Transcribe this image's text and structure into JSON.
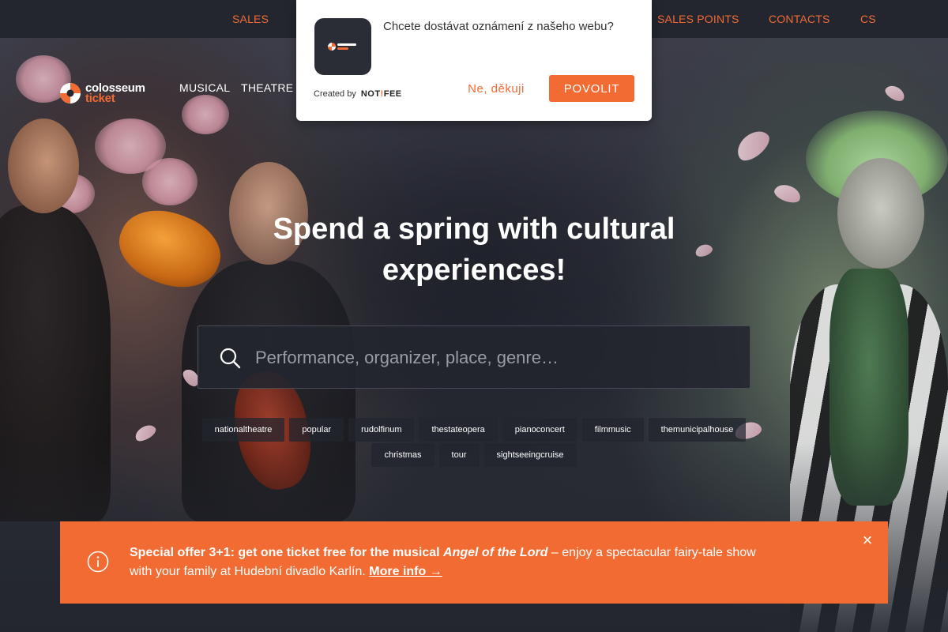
{
  "topbar": {
    "links": [
      "SALES",
      "SALES POINTS",
      "CONTACTS"
    ],
    "language": "CS"
  },
  "logo": {
    "line1": "colosseum",
    "line2": "ticket"
  },
  "mainnav": {
    "items": [
      "MUSICAL",
      "THEATRE"
    ]
  },
  "hero": {
    "title": "Spend a spring with cultural experiences!"
  },
  "search": {
    "placeholder": "Performance, organizer, place, genre…",
    "value": ""
  },
  "tags": {
    "row1": [
      "nationaltheatre",
      "popular",
      "rudolfinum",
      "thestateopera",
      "pianoconcert",
      "filmmusic",
      "themunicipalhouse"
    ],
    "row2": [
      "christmas",
      "tour",
      "sightseeingcruise"
    ]
  },
  "offer": {
    "prefix_glyph": "",
    "lead": "Special offer 3+1: get one ticket free for the musical",
    "title": "Angel of the Lord",
    "rest": "– enjoy a spectacular fairy-tale show with your family at Hudební divadlo Karlín.",
    "more": "More info →",
    "close": "×"
  },
  "popup": {
    "message": "Chcete dostávat oznámení z našeho webu?",
    "created_by": "Created by",
    "brand_a": "NOT",
    "brand_b": "!",
    "brand_c": "FEE",
    "deny": "Ne, děkuji",
    "allow": "POVOLIT"
  },
  "colors": {
    "accent": "#f16b33",
    "background": "#23262f",
    "popup_bg": "#ffffff"
  },
  "icons": [
    "search-icon",
    "info-icon",
    "close-icon",
    "logo-mark-icon"
  ]
}
